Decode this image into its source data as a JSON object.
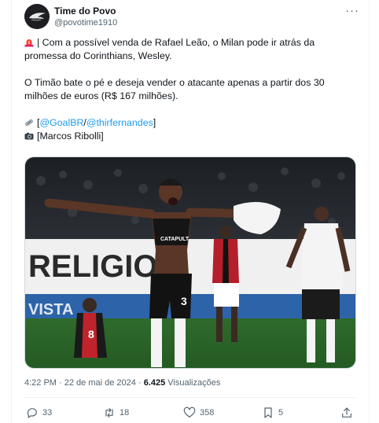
{
  "tweet": {
    "author_name": "Time do Povo",
    "author_handle": "@povotime1910",
    "line1": "| Com a possível venda de Rafael Leão, o Milan pode ir atrás da",
    "line2": "promessa do Corinthians, Wesley.",
    "line3": "O Timão bate o pé e deseja vender o atacante apenas a partir dos 30",
    "line4": "milhões de euros (R$ 167 milhões).",
    "source_open": "[",
    "source_link1": "@GoalBR",
    "source_slash": "/",
    "source_link2": "@thirfernandes",
    "source_close": "]",
    "photo_credit": "[Marcos Ribolli]",
    "emoji_alert": "siren-emoji",
    "emoji_link": "paperclip-emoji",
    "emoji_camera": "camera-emoji"
  },
  "media": {
    "description_icon": "football-celebration-photo",
    "jersey_number_main": "3",
    "jersey_number_opponent": "8",
    "sponsor": "CATAPULT",
    "banner_left": "RELIGIO",
    "banner_bottom": "VISTA"
  },
  "meta": {
    "time": "4:22 PM",
    "sep1": "·",
    "date": "22 de mai de 2024",
    "sep2": "·",
    "views_count": "6.425",
    "views_label": "Visualizações"
  },
  "actions": {
    "replies": "33",
    "reposts": "18",
    "likes": "358",
    "bookmarks": "5"
  },
  "colors": {
    "link": "#1d9bf0",
    "muted": "#536471",
    "text": "#0f1419"
  }
}
